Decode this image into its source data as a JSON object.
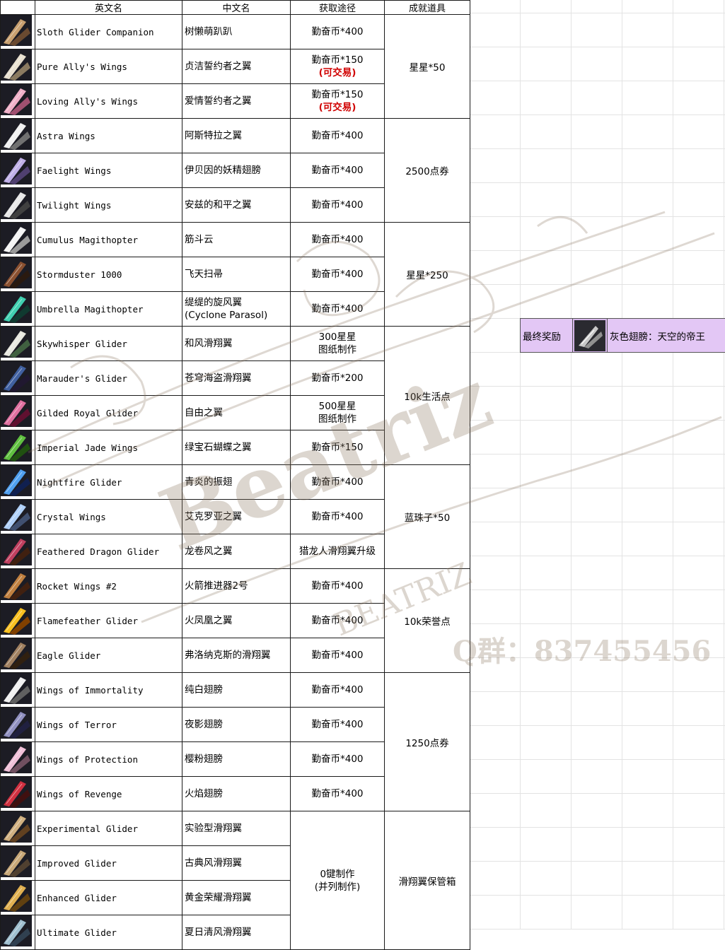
{
  "headers": {
    "icon": "",
    "en": "英文名",
    "cn": "中文名",
    "source": "获取途径",
    "achievement": "成就道具"
  },
  "rows": [
    {
      "en": "Sloth Glider Companion",
      "cn": "树懒萌趴趴",
      "src1": "勤奋币*400",
      "src2": "",
      "trade": "",
      "colors": [
        "#c8a070",
        "#6a4a30"
      ]
    },
    {
      "en": "Pure Ally's Wings",
      "cn": "贞洁誓约者之翼",
      "src1": "勤奋币*150",
      "src2": "",
      "trade": "(可交易)",
      "colors": [
        "#e8e0d0",
        "#8a7a60"
      ]
    },
    {
      "en": "Loving Ally's Wings",
      "cn": "爱情誓约者之翼",
      "src1": "勤奋币*150",
      "src2": "",
      "trade": "(可交易)",
      "colors": [
        "#f0b0c8",
        "#a05070"
      ]
    },
    {
      "en": "Astra Wings",
      "cn": "阿斯特拉之翼",
      "src1": "勤奋币*400",
      "src2": "",
      "trade": "",
      "colors": [
        "#f0f0f0",
        "#707070"
      ]
    },
    {
      "en": "Faelight Wings",
      "cn": "伊贝因的妖精翅膀",
      "src1": "勤奋币*400",
      "src2": "",
      "trade": "",
      "colors": [
        "#c0b0e8",
        "#504070"
      ]
    },
    {
      "en": "Twilight Wings",
      "cn": "安兹的和平之翼",
      "src1": "勤奋币*400",
      "src2": "",
      "trade": "",
      "colors": [
        "#e8e8e8",
        "#404040"
      ]
    },
    {
      "en": "Cumulus Magithopter",
      "cn": "筋斗云",
      "src1": "勤奋币*400",
      "src2": "",
      "trade": "",
      "colors": [
        "#f4f4f4",
        "#9a9a9a"
      ]
    },
    {
      "en": "Stormduster 1000",
      "cn": "飞天扫帚",
      "src1": "勤奋币*400",
      "src2": "",
      "trade": "",
      "colors": [
        "#8a5030",
        "#2a1a10"
      ]
    },
    {
      "en": "Umbrella Magithopter",
      "cn": "缇缇的旋风翼",
      "cn2": "(Cyclone Parasol)",
      "src1": "勤奋币*400",
      "src2": "",
      "trade": "",
      "colors": [
        "#40d0b0",
        "#103a30"
      ]
    },
    {
      "en": "Skywhisper Glider",
      "cn": "和风滑翔翼",
      "src1": "300星星",
      "src2": "图纸制作",
      "trade": "",
      "colors": [
        "#e8e8e0",
        "#406040"
      ]
    },
    {
      "en": "Marauder's Glider",
      "cn": "苍穹海盗滑翔翼",
      "src1": "勤奋币*200",
      "src2": "",
      "trade": "",
      "colors": [
        "#4060a0",
        "#201830"
      ]
    },
    {
      "en": "Gilded Royal Glider",
      "cn": "自由之翼",
      "src1": "500星星",
      "src2": "图纸制作",
      "trade": "",
      "colors": [
        "#e070a0",
        "#601030"
      ]
    },
    {
      "en": "Imperial Jade Wings",
      "cn": "绿宝石蝴蝶之翼",
      "src1": "勤奋币*150",
      "src2": "",
      "trade": "",
      "colors": [
        "#60c040",
        "#205010"
      ]
    },
    {
      "en": "Nightfire Glider",
      "cn": "青炎的振翅",
      "src1": "勤奋币*400",
      "src2": "",
      "trade": "",
      "colors": [
        "#50a0f0",
        "#102050"
      ]
    },
    {
      "en": "Crystal Wings",
      "cn": "艾克罗亚之翼",
      "src1": "勤奋币*400",
      "src2": "",
      "trade": "",
      "colors": [
        "#b0d0f8",
        "#405070"
      ]
    },
    {
      "en": "Feathered Dragon Glider",
      "cn": "龙卷风之翼",
      "src1": "猎龙人滑翔翼升级",
      "src2": "",
      "trade": "",
      "colors": [
        "#c04060",
        "#402010"
      ]
    },
    {
      "en": "Rocket Wings #2",
      "cn": "火箭推进器2号",
      "src1": "勤奋币*400",
      "src2": "",
      "trade": "",
      "colors": [
        "#c08040",
        "#402010"
      ]
    },
    {
      "en": "Flamefeather Glider",
      "cn": "火凤凰之翼",
      "src1": "勤奋币*400",
      "src2": "",
      "trade": "",
      "colors": [
        "#f8c020",
        "#804000"
      ]
    },
    {
      "en": "Eagle Glider",
      "cn": "弗洛纳克斯的滑翔翼",
      "src1": "勤奋币*400",
      "src2": "",
      "trade": "",
      "colors": [
        "#a08060",
        "#302010"
      ]
    },
    {
      "en": "Wings of Immortality",
      "cn": "纯白翅膀",
      "src1": "勤奋币*400",
      "src2": "",
      "trade": "",
      "colors": [
        "#f0f0f0",
        "#606060"
      ]
    },
    {
      "en": "Wings of Terror",
      "cn": "夜影翅膀",
      "src1": "勤奋币*400",
      "src2": "",
      "trade": "",
      "colors": [
        "#9090c0",
        "#202040"
      ]
    },
    {
      "en": "Wings of Protection",
      "cn": "樱粉翅膀",
      "src1": "勤奋币*400",
      "src2": "",
      "trade": "",
      "colors": [
        "#f0c0d8",
        "#705060"
      ]
    },
    {
      "en": "Wings of Revenge",
      "cn": "火焰翅膀",
      "src1": "勤奋币*400",
      "src2": "",
      "trade": "",
      "colors": [
        "#d03040",
        "#401010"
      ]
    },
    {
      "en": "Experimental Glider",
      "cn": "实验型滑翔翼",
      "src1": "",
      "src2": "",
      "trade": "",
      "colors": [
        "#d0b080",
        "#604020"
      ]
    },
    {
      "en": "Improved Glider",
      "cn": "古典风滑翔翼",
      "src1": "",
      "src2": "",
      "trade": "",
      "colors": [
        "#c8a878",
        "#504030"
      ]
    },
    {
      "en": "Enhanced Glider",
      "cn": "黄金荣耀滑翔翼",
      "src1": "",
      "src2": "",
      "trade": "",
      "colors": [
        "#e0b050",
        "#604010"
      ]
    },
    {
      "en": "Ultimate Glider",
      "cn": "夏日清风滑翔翼",
      "src1": "",
      "src2": "",
      "trade": "",
      "colors": [
        "#a0c0d0",
        "#304050"
      ]
    }
  ],
  "merged_source": {
    "line1": "0键制作",
    "line2": "(并列制作)"
  },
  "achievements": [
    {
      "label": "星星*50",
      "start": 0,
      "span": 3
    },
    {
      "label": "2500点券",
      "start": 3,
      "span": 3
    },
    {
      "label": "星星*250",
      "start": 6,
      "span": 3
    },
    {
      "label": "10k生活点",
      "start": 9,
      "span": 4
    },
    {
      "label": "蓝珠子*50",
      "start": 13,
      "span": 3
    },
    {
      "label": "10k荣誉点",
      "start": 16,
      "span": 3
    },
    {
      "label": "1250点券",
      "start": 19,
      "span": 4
    },
    {
      "label": "滑翔翼保管箱",
      "start": 23,
      "span": 4
    }
  ],
  "reward": {
    "label": "最终奖励",
    "text": "灰色翅膀：天空的帝王",
    "icon": "gray-wings-icon"
  },
  "watermark": {
    "name": "Beatriz",
    "name_caps": "BEATRIZ",
    "qq": "Q群：837455456"
  }
}
